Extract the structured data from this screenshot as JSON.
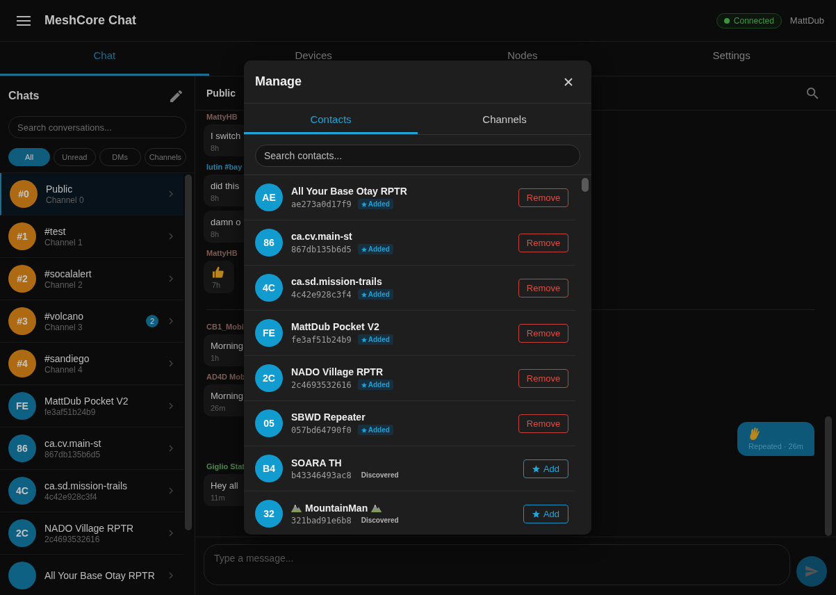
{
  "header": {
    "title": "MeshCore Chat",
    "status": {
      "label": "Connected",
      "connected": true
    },
    "user": "MattDub"
  },
  "tabs": [
    {
      "label": "Chat",
      "selected": true
    },
    {
      "label": "Devices",
      "selected": false
    },
    {
      "label": "Nodes",
      "selected": false
    },
    {
      "label": "Settings",
      "selected": false
    }
  ],
  "sidebar": {
    "title": "Chats",
    "search": {
      "placeholder": "Search conversations..."
    },
    "filters": [
      {
        "label": "All",
        "selected": true
      },
      {
        "label": "Unread",
        "selected": false
      },
      {
        "label": "DMs",
        "selected": false
      },
      {
        "label": "Channels",
        "selected": false
      }
    ],
    "conversations": [
      {
        "kind": "channel",
        "avatar": "#0",
        "name": "Public",
        "subtitle": "Channel 0",
        "selected": true
      },
      {
        "kind": "channel",
        "avatar": "#1",
        "name": "#test",
        "subtitle": "Channel 1",
        "selected": false
      },
      {
        "kind": "channel",
        "avatar": "#2",
        "name": "#socalalert",
        "subtitle": "Channel 2",
        "selected": false
      },
      {
        "kind": "channel",
        "avatar": "#3",
        "name": "#volcano",
        "subtitle": "Channel 3",
        "unread": "2",
        "selected": false
      },
      {
        "kind": "channel",
        "avatar": "#4",
        "name": "#sandiego",
        "subtitle": "Channel 4",
        "selected": false
      },
      {
        "kind": "contact",
        "avatar": "FE",
        "name": "MattDub Pocket V2",
        "subtitle": "fe3af51b24b9",
        "selected": false
      },
      {
        "kind": "contact",
        "avatar": "86",
        "name": "ca.cv.main-st",
        "subtitle": "867db135b6d5",
        "selected": false
      },
      {
        "kind": "contact",
        "avatar": "4C",
        "name": "ca.sd.mission-trails",
        "subtitle": "4c42e928c3f4",
        "selected": false
      },
      {
        "kind": "contact",
        "avatar": "2C",
        "name": "NADO Village RPTR",
        "subtitle": "2c4693532616",
        "selected": false
      },
      {
        "kind": "contact",
        "name": "All Your Base Otay RPTR",
        "selected": false
      }
    ]
  },
  "chat": {
    "title": "Public",
    "messages": [
      {
        "kind": "incoming",
        "sender": "MattyHB",
        "color": "#7d5d54",
        "bubbles": [
          {
            "kind": "text",
            "text": "I switch",
            "time": "8h"
          }
        ]
      },
      {
        "kind": "incoming",
        "sender": "lutin #bay",
        "color": "#2a82a6",
        "bubbles": [
          {
            "kind": "text",
            "text": "did this",
            "time": "8h"
          },
          {
            "kind": "text",
            "text": "damn o",
            "time": "8h"
          }
        ]
      },
      {
        "kind": "incoming",
        "sender": "MattyHB",
        "color": "#7d5d54",
        "bubbles": [
          {
            "kind": "thumbs_up",
            "time": "7h"
          }
        ]
      },
      {
        "kind": "separator"
      },
      {
        "kind": "incoming",
        "sender": "CB1_Mobi",
        "color": "#7d5d54",
        "bubbles": [
          {
            "kind": "text",
            "text": "Morning",
            "time": "1h"
          }
        ]
      },
      {
        "kind": "incoming",
        "sender": "AD4D Mob",
        "color": "#7d5d54",
        "bubbles": [
          {
            "kind": "text",
            "text": "Morning",
            "time": "26m"
          }
        ]
      },
      {
        "kind": "outgoing",
        "bubbles": [
          {
            "kind": "waving_hand",
            "time": "Repeated · 26m"
          }
        ]
      },
      {
        "kind": "incoming",
        "sender": "Giglio Stat",
        "color": "#4d8a4e",
        "bubbles": [
          {
            "kind": "text",
            "text": "Hey all",
            "time": "11m"
          }
        ]
      }
    ],
    "composer": {
      "placeholder": "Type a message..."
    }
  },
  "modal": {
    "title": "Manage",
    "tabs": [
      {
        "label": "Contacts",
        "selected": true
      },
      {
        "label": "Channels",
        "selected": false
      }
    ],
    "search": {
      "placeholder": "Search contacts..."
    },
    "contacts": [
      {
        "kind": "added",
        "avatar": "AE",
        "name": "All Your Base Otay RPTR",
        "key": "ae273a0d17f9",
        "badge": "Added",
        "action": "Remove"
      },
      {
        "kind": "added",
        "avatar": "86",
        "name": "ca.cv.main-st",
        "key": "867db135b6d5",
        "badge": "Added",
        "action": "Remove"
      },
      {
        "kind": "added",
        "avatar": "4C",
        "name": "ca.sd.mission-trails",
        "key": "4c42e928c3f4",
        "badge": "Added",
        "action": "Remove"
      },
      {
        "kind": "added",
        "avatar": "FE",
        "name": "MattDub Pocket V2",
        "key": "fe3af51b24b9",
        "badge": "Added",
        "action": "Remove"
      },
      {
        "kind": "added",
        "avatar": "2C",
        "name": "NADO Village RPTR",
        "key": "2c4693532616",
        "badge": "Added",
        "action": "Remove"
      },
      {
        "kind": "added",
        "avatar": "05",
        "name": "SBWD Repeater",
        "key": "057bd64790f0",
        "badge": "Added",
        "action": "Remove"
      },
      {
        "kind": "discovered",
        "avatar": "B4",
        "name": "SOARA TH",
        "key": "b43346493ac8",
        "badge": "Discovered",
        "action": "Add"
      },
      {
        "kind": "discovered",
        "avatar": "32",
        "name": "MountainMan",
        "decor": {
          "kind": "mountain"
        },
        "key": "321bad91e6b8",
        "badge": "Discovered",
        "action": "Add"
      }
    ]
  }
}
